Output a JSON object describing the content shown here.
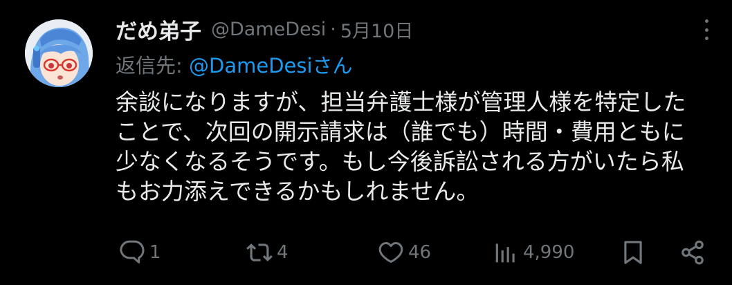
{
  "post": {
    "author_name": "だめ弟子",
    "handle": "@DameDesi",
    "separator": "·",
    "date": "5月10日",
    "reply_label": "返信先: ",
    "reply_to": "@DameDesiさん",
    "text": "余談になりますが、担当弁護士様が管理人様を特定した\nことで、次回の開示請求は（誰でも）時間・費用ともに\n少なくなるそうです。もし今後訴訟される方がいたら私\nもお力添えできるかもしれません。"
  },
  "actions": {
    "replies": "1",
    "reposts": "4",
    "likes": "46",
    "views": "4,990"
  },
  "icons": [
    "more-icon",
    "reply-icon",
    "repost-icon",
    "like-icon",
    "views-icon",
    "bookmark-icon",
    "share-icon"
  ],
  "colors": {
    "background": "#000000",
    "text": "#e7e9ea",
    "secondary": "#71767b",
    "link": "#1d9bf0"
  }
}
